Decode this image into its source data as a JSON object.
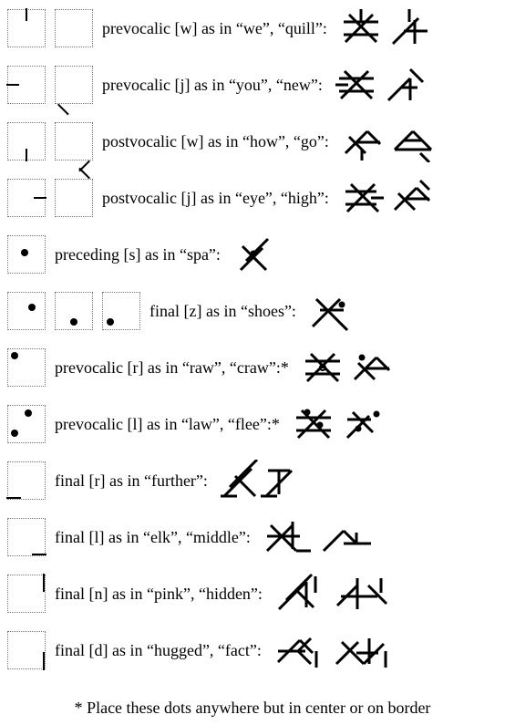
{
  "rows": [
    {
      "label": "prevocalic [w] as in “we”, “quill”:"
    },
    {
      "label": "prevocalic [j] as in “you”, “new”:"
    },
    {
      "label": "postvocalic [w] as in “how”, “go”:"
    },
    {
      "label": "postvocalic [j] as in “eye”, “high”:"
    },
    {
      "label": "preceding [s] as in “spa”:"
    },
    {
      "label": "final [z] as in “shoes”:"
    },
    {
      "label": "prevocalic [r] as in “raw”, “craw”:*"
    },
    {
      "label": "prevocalic [l] as in “law”, “flee”:*"
    },
    {
      "label": "final [r] as in “further”:"
    },
    {
      "label": "final [l] as in “elk”, “middle”:"
    },
    {
      "label": "final [n] as in “pink”, “hidden”:"
    },
    {
      "label": "final [d] as in “hugged”, “fact”:"
    }
  ],
  "footnote": "* Place these dots anywhere but in center or on border"
}
